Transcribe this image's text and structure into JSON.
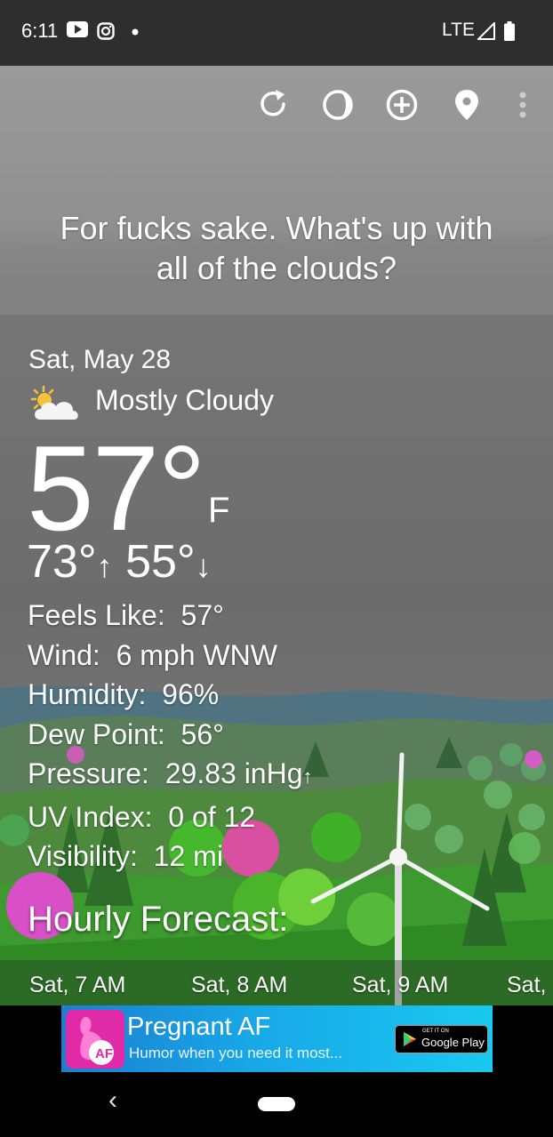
{
  "status_bar": {
    "time": "6:11",
    "network": "LTE",
    "icons": [
      "youtube-icon",
      "instagram-icon",
      "notification-dot-icon",
      "signal-icon",
      "battery-icon"
    ]
  },
  "toolbar": {
    "icons": [
      "refresh-icon",
      "theme-icon",
      "add-location-icon",
      "location-pin-icon",
      "overflow-menu-icon"
    ]
  },
  "headline": {
    "line1": "For fucks sake. What's up with",
    "line2": "all of the clouds?"
  },
  "current": {
    "date": "Sat, May 28",
    "condition": "Mostly Cloudy",
    "condition_icon": "partly-cloudy-icon",
    "temperature": "57°",
    "unit": "F",
    "high": "73°",
    "low": "55°"
  },
  "details": [
    {
      "label": "Feels Like:",
      "value": "57°"
    },
    {
      "label": "Wind:",
      "value": "6 mph WNW"
    },
    {
      "label": "Humidity:",
      "value": "96%"
    },
    {
      "label": "Dew Point:",
      "value": "56°"
    },
    {
      "label": "Pressure:",
      "value": "29.83 inHg",
      "trend": "↑"
    },
    {
      "label": "UV Index:",
      "value": "0 of 12"
    },
    {
      "label": "Visibility:",
      "value": "12 mi"
    }
  ],
  "hourly": {
    "title": "Hourly Forecast:",
    "times": [
      "Sat, 7 AM",
      "Sat, 8 AM",
      "Sat, 9 AM",
      "Sat,"
    ]
  },
  "ad": {
    "title": "Pregnant AF",
    "subtitle": "Humor when you need it most...",
    "badge_small": "GET IT ON",
    "badge_large": "Google Play"
  },
  "nav": {
    "back_glyph": "‹"
  },
  "colors": {
    "status_bar": "#2e2e2e",
    "sky": "#6c6c6c",
    "ad_start": "#1a7fd0",
    "ad_end": "#19c9ef"
  }
}
